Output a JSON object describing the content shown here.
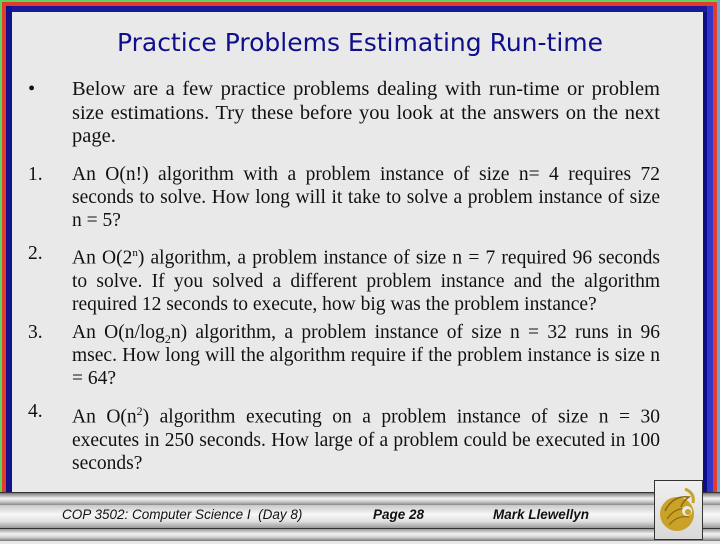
{
  "slide": {
    "title": "Practice Problems Estimating Run-time",
    "intro": {
      "marker": "•",
      "text": "Below are a few practice problems dealing with run-time or problem size estimations.  Try these before you look at the answers on the next page."
    },
    "problems": [
      {
        "marker": "1.",
        "pre": "An O(n!) algorithm with a problem instance of size n= 4 requires 72 seconds to solve.  How long will it take to solve a problem instance of size n = 5?",
        "sup": "",
        "sub": "",
        "post": ""
      },
      {
        "marker": "2.",
        "pre": "An O(2",
        "sup": "n",
        "sub": "",
        "post": ") algorithm, a problem instance of size n = 7 required 96 seconds to solve.  If you solved a different problem instance and the algorithm required 12 seconds to execute, how big was the problem instance?"
      },
      {
        "marker": "3.",
        "pre": "An O(n/log",
        "sup": "",
        "sub": "2",
        "post": "n) algorithm, a problem instance of size n = 32 runs in 96 msec.  How long will the algorithm require if the problem instance is size n = 64?"
      },
      {
        "marker": "4.",
        "pre": "An O(n",
        "sup": "2",
        "sub": "",
        "post": ") algorithm executing on a problem instance of size n = 30 executes in 250 seconds.  How large of a problem could be executed in 100 seconds?"
      }
    ]
  },
  "footer": {
    "course": "COP 3502: Computer Science I  (Day 8)",
    "page": "Page 28",
    "author": "Mark Llewellyn",
    "logo": "ucf-pegasus-logo"
  },
  "colors": {
    "title": "#0f0f8c",
    "background": "#e9e9e9",
    "border_red": "#e53b2c",
    "border_navy": "#12128a",
    "border_blue": "#3535c8",
    "border_green": "#5fd35f",
    "logo_gold": "#c9a227"
  }
}
